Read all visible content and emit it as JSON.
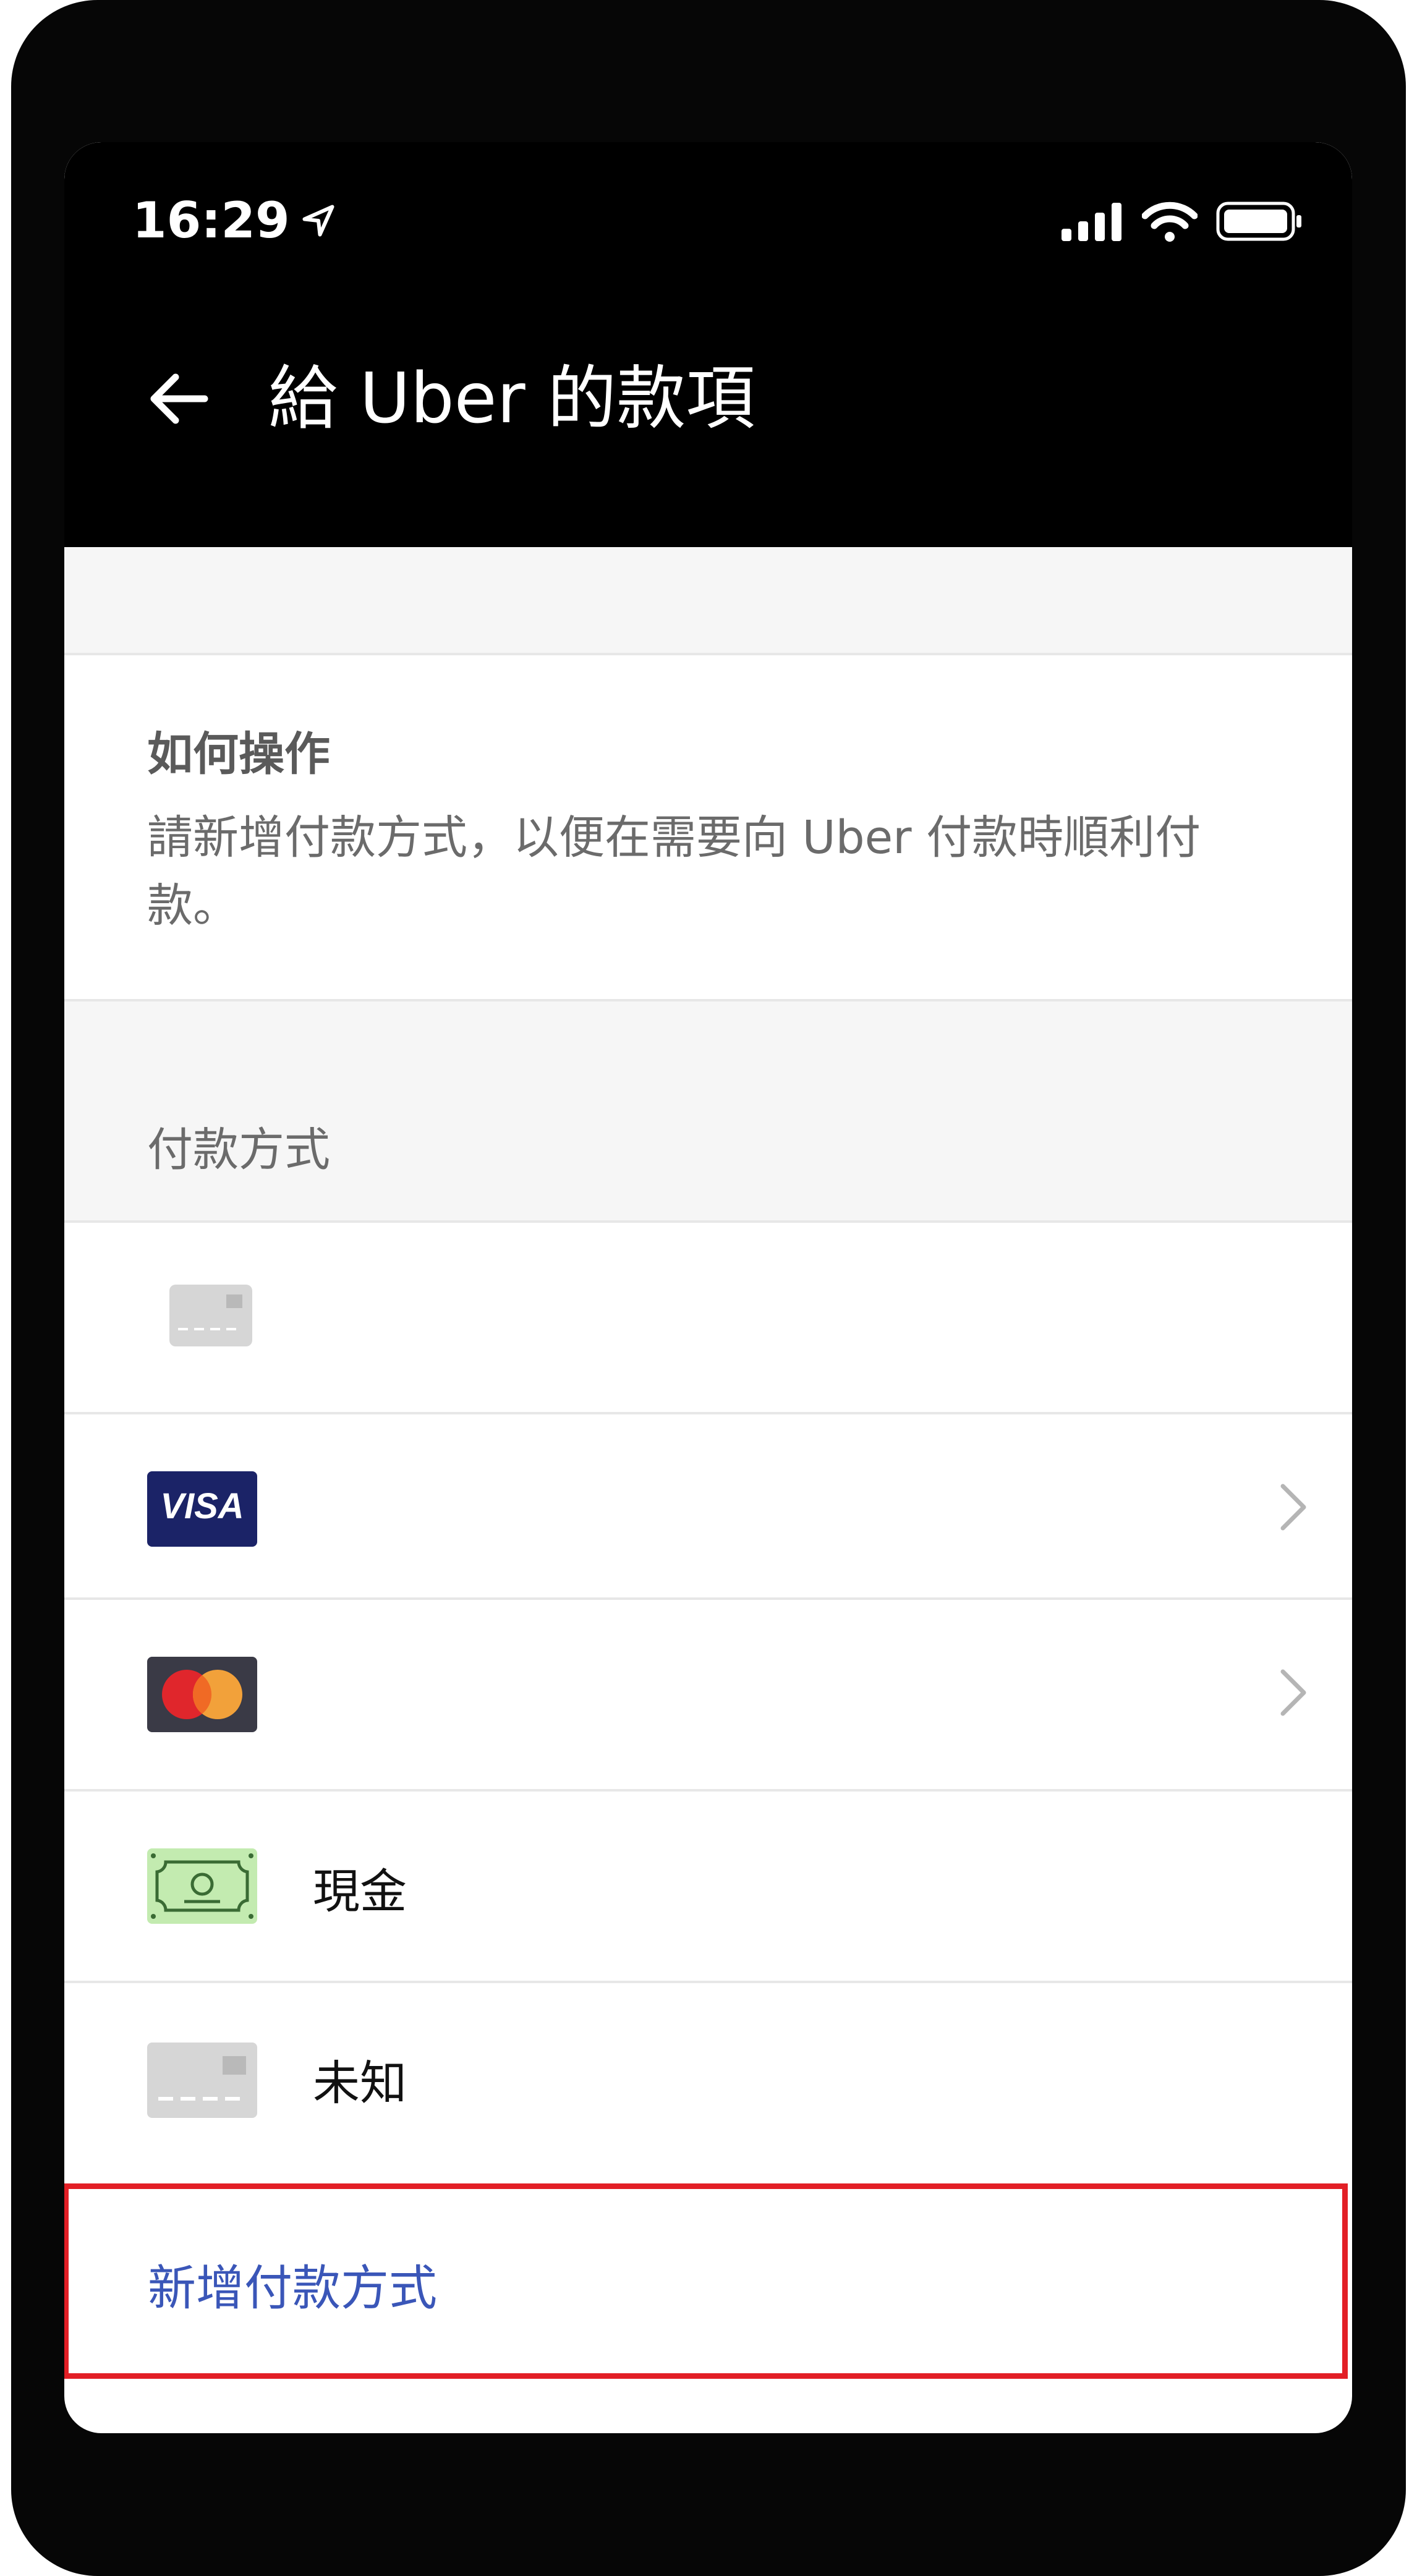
{
  "status_bar": {
    "time": "16:29"
  },
  "header": {
    "title": "給 Uber 的款項"
  },
  "how_it_works": {
    "title": "如何操作",
    "description": "請新增付款方式，以便在需要向 Uber 付款時順利付款。"
  },
  "payment_methods": {
    "section_label": "付款方式",
    "items": [
      {
        "icon": "generic-card-icon",
        "label": "",
        "has_chevron": false
      },
      {
        "icon": "visa-icon",
        "label": "",
        "has_chevron": true
      },
      {
        "icon": "mastercard-icon",
        "label": "",
        "has_chevron": true
      },
      {
        "icon": "cash-icon",
        "label": "現金",
        "has_chevron": false
      },
      {
        "icon": "unknown-card-icon",
        "label": "未知",
        "has_chevron": false
      }
    ],
    "add_label": "新增付款方式"
  },
  "colors": {
    "accent": "#3a56b8",
    "highlight": "#e21f26",
    "cash_green": "#c3ebb0"
  }
}
